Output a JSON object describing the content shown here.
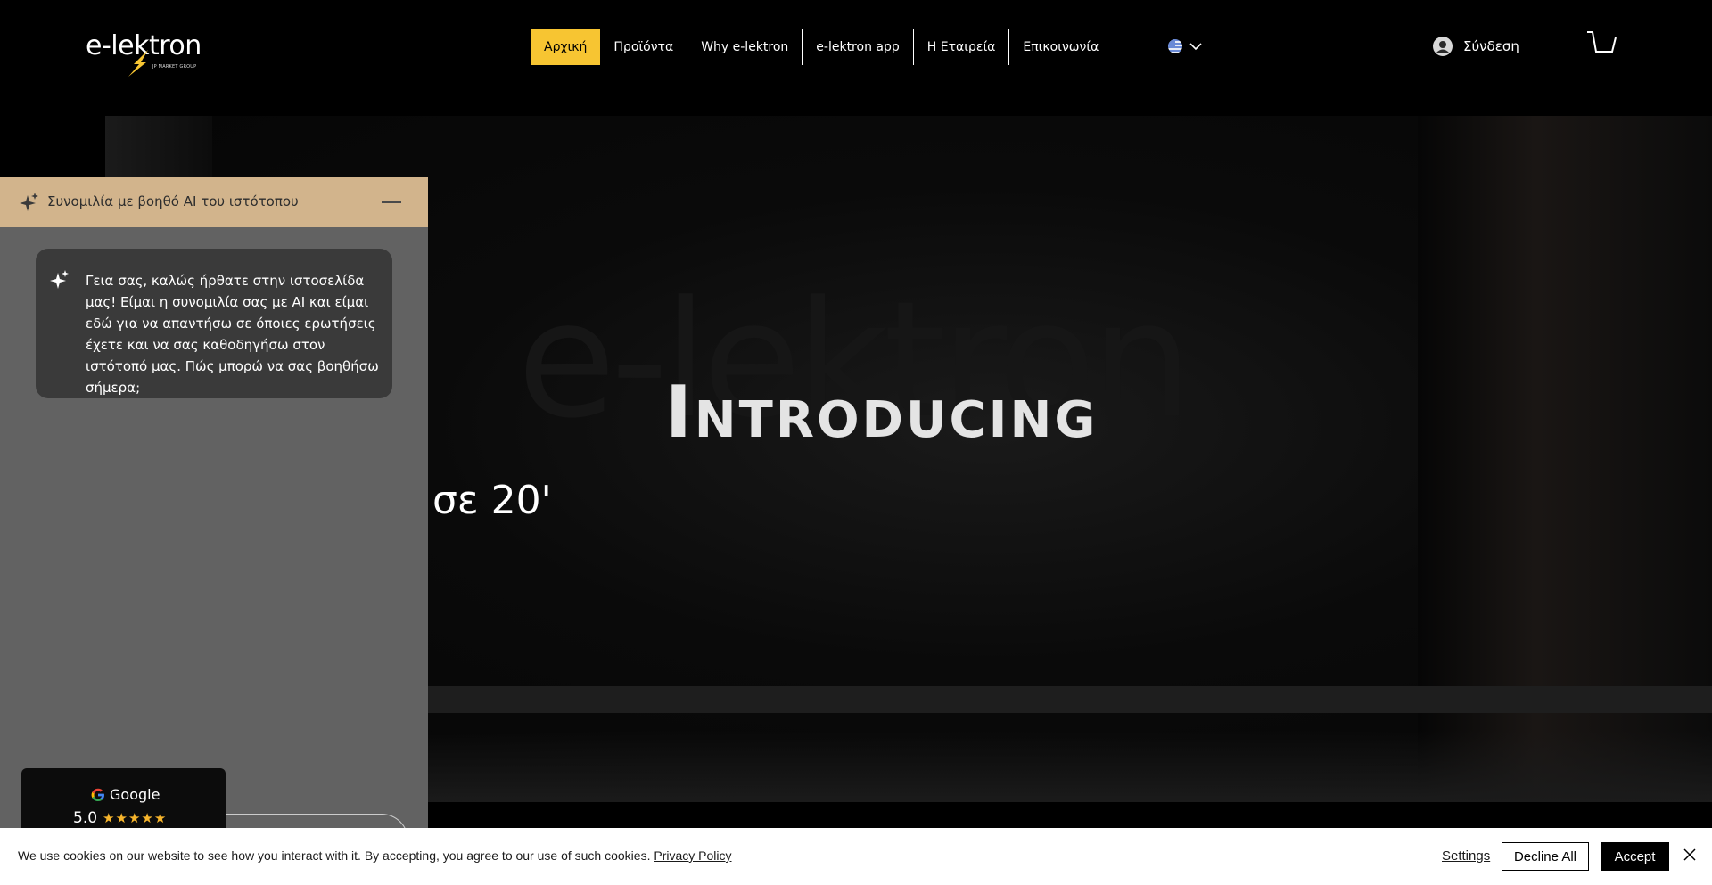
{
  "header": {
    "logo_text": "e-lektron",
    "logo_sub": "JP MARKET GROUP",
    "nav": [
      {
        "label": "Αρχική",
        "active": true
      },
      {
        "label": "Προϊόντα"
      },
      {
        "label": "Why e-lektron"
      },
      {
        "label": "e-lektron app"
      },
      {
        "label": "Η Εταιρεία"
      },
      {
        "label": "Επικοινωνία"
      }
    ],
    "login_label": "Σύνδεση",
    "accent": "#f7c532"
  },
  "hero": {
    "ghost_text": "e-lektron",
    "headline": "Introducing",
    "partial_text": "σε 20'"
  },
  "chat": {
    "title": "Συνομιλία με βοηθό AI του ιστότοπου",
    "message": "Γεια σας, καλώς ήρθατε στην ιστοσελίδα μας! Είμαι η συνομιλία σας με AI και είμαι εδώ για να απαντήσω σε όποιες ερωτήσεις έχετε και να σας καθοδηγήσω στον ιστότοπό μας. Πώς μπορώ να σας βοηθήσω σήμερα;",
    "header_color": "#d2b48c"
  },
  "google_badge": {
    "label": "Google",
    "score": "5.0",
    "stars": "★★★★★"
  },
  "cookie": {
    "text": "We use cookies on our website to see how you interact with it. By accepting, you agree to our use of such cookies.",
    "link": "Privacy Policy",
    "settings": "Settings",
    "decline": "Decline All",
    "accept": "Accept"
  }
}
